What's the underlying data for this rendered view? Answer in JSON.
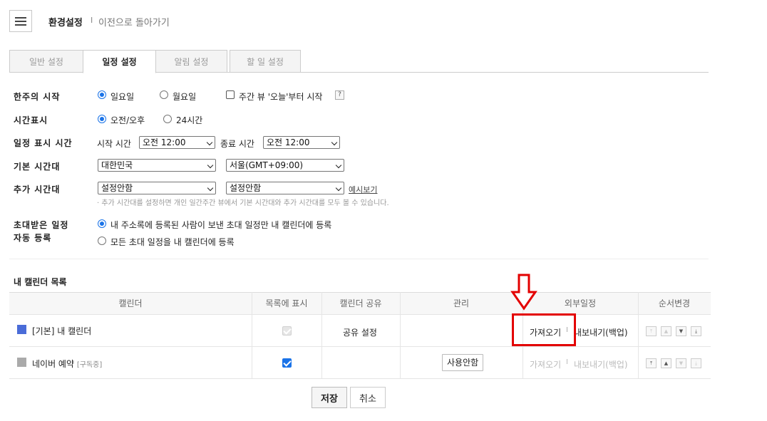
{
  "header": {
    "title": "환경설정",
    "separator": "I",
    "back_link": "이전으로 돌아가기"
  },
  "tabs": [
    {
      "label": "일반 설정",
      "active": false
    },
    {
      "label": "일정 설정",
      "active": true
    },
    {
      "label": "알림 설정",
      "active": false
    },
    {
      "label": "할 일 설정",
      "active": false
    }
  ],
  "settings": {
    "week_start": {
      "label": "한주의 시작",
      "options": [
        "일요일",
        "월요일"
      ],
      "selected": "일요일",
      "weekly_today_label": "주간 뷰 '오늘'부터 시작",
      "weekly_today_checked": false,
      "help": "?"
    },
    "time_display": {
      "label": "시간표시",
      "options": [
        "오전/오후",
        "24시간"
      ],
      "selected": "오전/오후"
    },
    "display_time": {
      "label": "일정 표시 시간",
      "start_label": "시작 시간",
      "start_value": "오전 12:00",
      "end_label": "종료 시간",
      "end_value": "오전 12:00"
    },
    "base_timezone": {
      "label": "기본 시간대",
      "country": "대한민국",
      "zone": "서울(GMT+09:00)"
    },
    "extra_timezone": {
      "label": "추가 시간대",
      "country": "설정안함",
      "zone": "설정안함",
      "preview_link": "예시보기",
      "note": "· 추가 시간대를 설정하면 개인 일간주간 뷰에서 기본 시간대와 추가 시간대를 모두 볼 수 있습니다."
    },
    "invited": {
      "label_line1": "초대받은 일정",
      "label_line2": "자동 등록",
      "options": [
        "내 주소록에 등록된 사람이 보낸 초대 일정만 내 캘린더에 등록",
        "모든 초대 일정을 내 캘린더에 등록"
      ],
      "selected": 0
    }
  },
  "calendar_list": {
    "title": "내 캘린더 목록",
    "headers": [
      "캘린더",
      "목록에 표시",
      "캘린더 공유",
      "관리",
      "외부일정",
      "순서변경"
    ],
    "rows": [
      {
        "name": "[기본] 내 캘린더",
        "tag": "",
        "color": "#4a6cd8",
        "show_in_list": true,
        "show_disabled": true,
        "share": "공유 설정",
        "manage": "",
        "import": "가져오기",
        "sep": "I",
        "export": "내보내기(백업)",
        "external_enabled": true
      },
      {
        "name": "네이버 예약",
        "tag": "[구독중]",
        "color": "#aaaaaa",
        "show_in_list": true,
        "show_disabled": false,
        "share": "",
        "manage": "사용안함",
        "import": "가져오기",
        "sep": "I",
        "export": "내보내기(백업)",
        "external_enabled": false
      }
    ]
  },
  "icons": {
    "menu": "hamburger-icon",
    "annotation": "red-down-arrow-icon",
    "order_top": "⤒",
    "order_up": "▲",
    "order_down": "▼",
    "order_bottom": "⤓"
  },
  "colors": {
    "accent": "#1a73e8",
    "annotation": "#e30000"
  },
  "footer": {
    "save": "저장",
    "cancel": "취소"
  }
}
